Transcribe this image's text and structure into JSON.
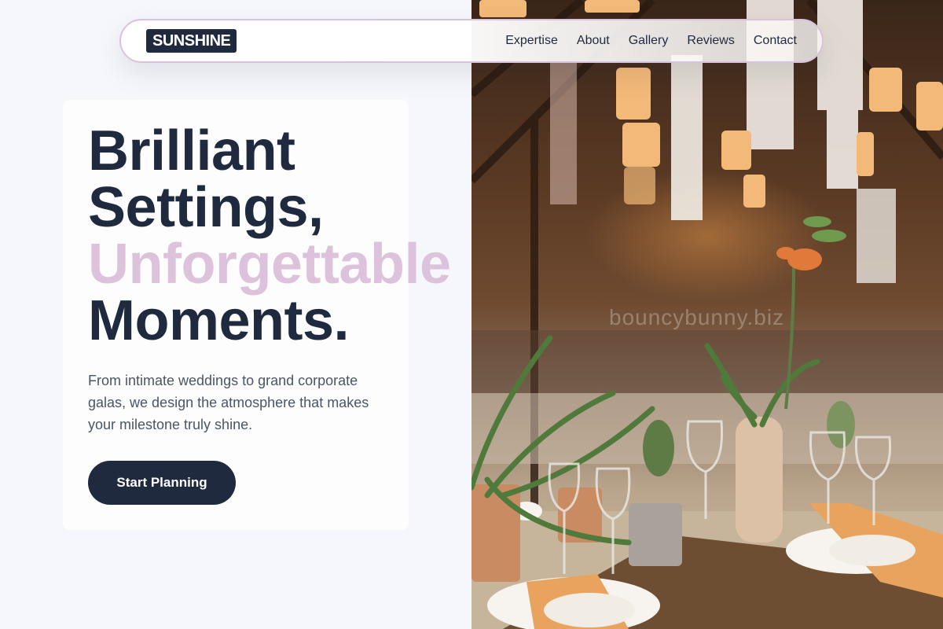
{
  "nav": {
    "logo": "SUNSHINE",
    "links": [
      "Expertise",
      "About",
      "Gallery",
      "Reviews",
      "Contact"
    ]
  },
  "hero": {
    "headline": {
      "line1": "Brilliant",
      "line2": "Settings,",
      "line3": "Unforgettable",
      "line4": "Moments."
    },
    "subtext": "From intimate weddings to grand corporate galas, we design the atmosphere that makes your milestone truly shine.",
    "cta_label": "Start Planning",
    "image": {
      "alt": "Rustic barn venue with lanterns, draped fabric and decorated dining tables",
      "watermark": "bouncybunny.biz"
    }
  },
  "colors": {
    "navy": "#1f2a3f",
    "accent_pink": "#dcc3db",
    "nav_border": "#d9c2dc",
    "page_bg": "#f6f7fc"
  }
}
